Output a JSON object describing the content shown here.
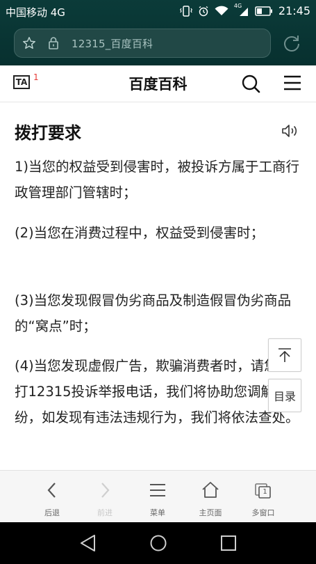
{
  "status_bar": {
    "carrier": "中国移动 4G",
    "time": "21:45",
    "network_badge": "4G"
  },
  "browser": {
    "url": "12315_百度百科",
    "toolbar": [
      {
        "label": "后退",
        "icon": "back-arrow-icon",
        "enabled": true
      },
      {
        "label": "前进",
        "icon": "forward-arrow-icon",
        "enabled": false
      },
      {
        "label": "菜单",
        "icon": "menu-lines-icon",
        "enabled": true
      },
      {
        "label": "主页面",
        "icon": "home-icon",
        "enabled": true
      },
      {
        "label": "多窗口",
        "icon": "windows-icon",
        "enabled": true,
        "badge": "1"
      }
    ]
  },
  "site_header": {
    "ta_label": "TA",
    "ta_badge": "1",
    "title": "百度百科"
  },
  "article": {
    "section_title": "拨打要求",
    "paragraphs": [
      "1)当您的权益受到侵害时，被投诉方属于工商行政管理部门管辖时；",
      "(2)当您在消费过程中，权益受到侵害时；",
      "(3)当您发现假冒伪劣商品及制造假冒伪劣商品的“窝点”时；",
      "(4)当您发现虚假广告，欺骗消费者时，请您拨打12315投诉举报电话，我们将协助您调解纠纷，如发现有违法违规行为，我们将依法查处。"
    ]
  },
  "floating": {
    "toc_label": "目录"
  },
  "colors": {
    "topbar": "#07302f",
    "badge_red": "#e53935"
  }
}
